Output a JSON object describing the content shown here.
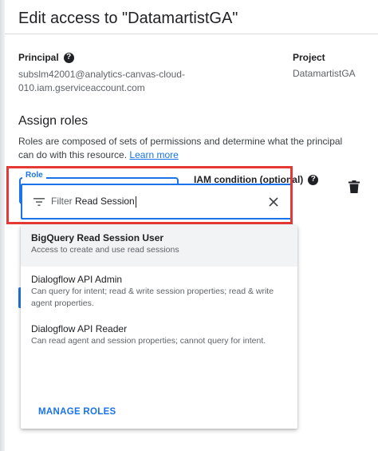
{
  "dialog": {
    "title": "Edit access to \"DatamartistGA\""
  },
  "principal": {
    "label": "Principal",
    "value": "subslm42001@analytics-canvas-cloud-010.iam.gserviceaccount.com"
  },
  "project": {
    "label": "Project",
    "value": "DatamartistGA"
  },
  "assign_roles": {
    "title": "Assign roles",
    "description": "Roles are composed of sets of permissions and determine what the principal can do with this resource.",
    "learn_more": "Learn more"
  },
  "role_field": {
    "label": "Role"
  },
  "iam_condition": {
    "label": "IAM condition (optional)"
  },
  "filter": {
    "prefix": "Filter",
    "value": "Read Session"
  },
  "options": [
    {
      "title": "BigQuery Read Session User",
      "description": "Access to create and use read sessions"
    },
    {
      "title": "Dialogflow API Admin",
      "description": "Can query for intent; read & write session properties; read & write agent properties."
    },
    {
      "title": "Dialogflow API Reader",
      "description": "Can read agent and session properties; cannot query for intent."
    }
  ],
  "manage_roles": "MANAGE ROLES",
  "colors": {
    "accent": "#1a73e8",
    "highlight": "#e53935",
    "selected_row": "#f1f3f4"
  }
}
